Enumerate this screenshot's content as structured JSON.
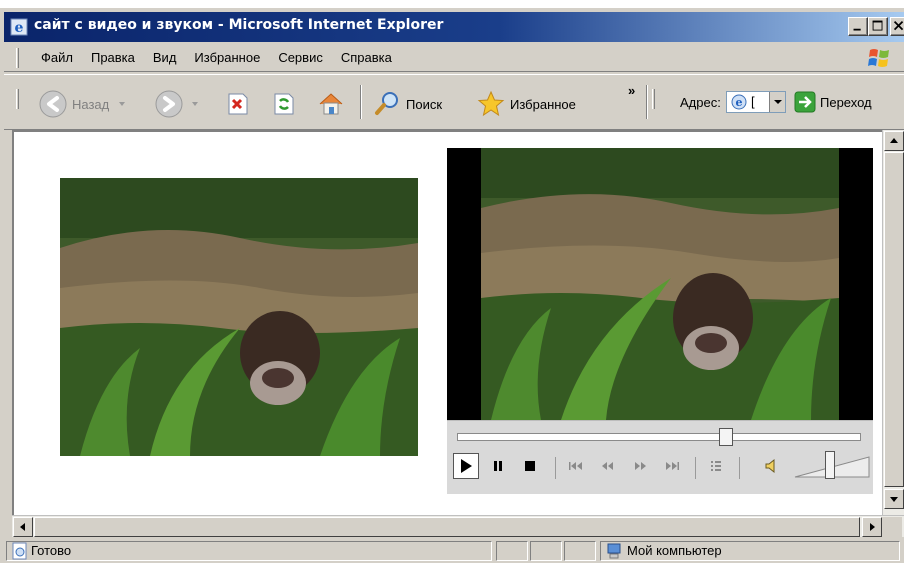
{
  "window": {
    "title": "сайт с видео и звуком - Microsoft Internet Explorer",
    "app_icon": "ie-icon",
    "controls": [
      "minimize-icon",
      "maximize-icon",
      "close-icon"
    ]
  },
  "menu": {
    "items": [
      {
        "label": "Файл",
        "name": "menu-file"
      },
      {
        "label": "Правка",
        "name": "menu-edit"
      },
      {
        "label": "Вид",
        "name": "menu-view"
      },
      {
        "label": "Избранное",
        "name": "menu-favorites"
      },
      {
        "label": "Сервис",
        "name": "menu-tools"
      },
      {
        "label": "Справка",
        "name": "menu-help"
      }
    ]
  },
  "toolbar": {
    "back_label": "Назад",
    "search_label": "Поиск",
    "favorites_label": "Избранное",
    "chevron": "»",
    "address_label": "Адрес:",
    "go_label": "Переход",
    "address_value": "[",
    "icons": [
      "back-icon",
      "forward-icon",
      "stop-icon",
      "refresh-icon",
      "home-icon",
      "search-icon",
      "favorites-star-icon",
      "go-icon"
    ]
  },
  "media_player": {
    "seek_fraction": 0.67,
    "volume_fraction": 0.45,
    "controls": [
      "play-icon",
      "pause-icon",
      "stop-icon",
      "previous-icon",
      "rewind-icon",
      "fast-forward-icon",
      "next-icon",
      "playlist-icon",
      "mute-icon"
    ]
  },
  "status": {
    "text": "Готово",
    "zone": "Мой компьютер"
  },
  "colors": {
    "title_bar": "#0a246a",
    "chrome": "#d4d0c8",
    "page_bg": "#ffffff"
  }
}
